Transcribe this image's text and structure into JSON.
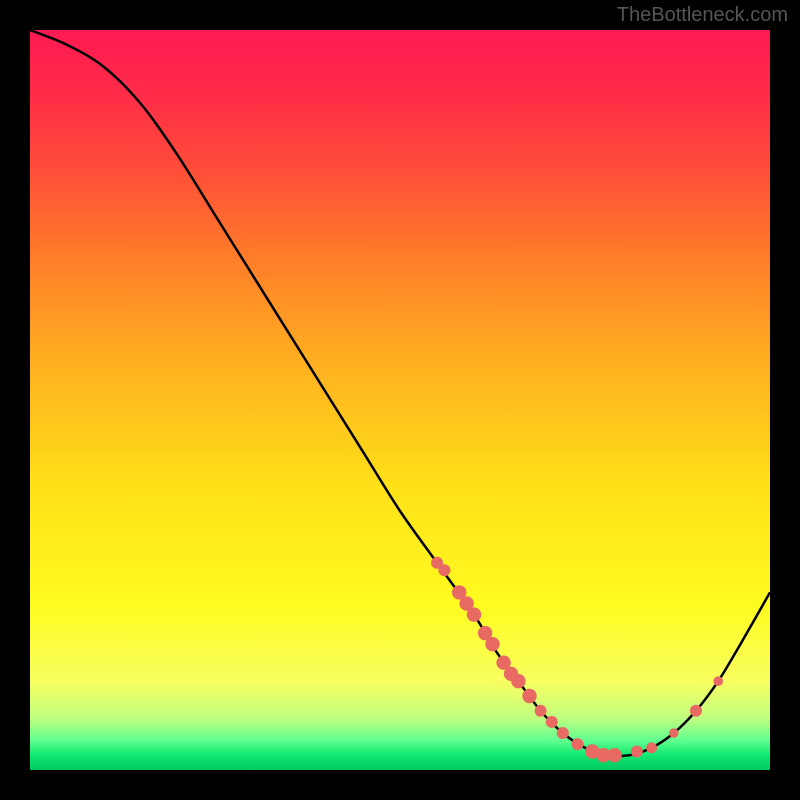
{
  "watermark": "TheBottleneck.com",
  "chart_data": {
    "type": "line",
    "title": "",
    "xlabel": "",
    "ylabel": "",
    "xlim": [
      0,
      100
    ],
    "ylim": [
      0,
      100
    ],
    "series": [
      {
        "name": "curve",
        "x": [
          0,
          5,
          10,
          15,
          20,
          25,
          30,
          35,
          40,
          45,
          50,
          55,
          60,
          63,
          66,
          69,
          72,
          75,
          78,
          81,
          84,
          87,
          90,
          93,
          96,
          100
        ],
        "y": [
          100,
          98,
          95,
          90,
          83,
          75,
          67,
          59,
          51,
          43,
          35,
          28,
          21,
          16,
          12,
          8,
          5,
          3,
          2,
          2,
          3,
          5,
          8,
          12,
          17,
          24
        ]
      }
    ],
    "markers": [
      {
        "x": 55,
        "y": 28,
        "r": 1.0
      },
      {
        "x": 56,
        "y": 27,
        "r": 1.0
      },
      {
        "x": 58,
        "y": 24,
        "r": 1.2
      },
      {
        "x": 59,
        "y": 22.5,
        "r": 1.2
      },
      {
        "x": 60,
        "y": 21,
        "r": 1.2
      },
      {
        "x": 61.5,
        "y": 18.5,
        "r": 1.2
      },
      {
        "x": 62.5,
        "y": 17,
        "r": 1.2
      },
      {
        "x": 64,
        "y": 14.5,
        "r": 1.2
      },
      {
        "x": 65,
        "y": 13,
        "r": 1.2
      },
      {
        "x": 66,
        "y": 12,
        "r": 1.2
      },
      {
        "x": 67.5,
        "y": 10,
        "r": 1.2
      },
      {
        "x": 69,
        "y": 8,
        "r": 1.0
      },
      {
        "x": 70.5,
        "y": 6.5,
        "r": 1.0
      },
      {
        "x": 72,
        "y": 5,
        "r": 1.0
      },
      {
        "x": 74,
        "y": 3.5,
        "r": 1.0
      },
      {
        "x": 76,
        "y": 2.5,
        "r": 1.2
      },
      {
        "x": 77.5,
        "y": 2,
        "r": 1.2
      },
      {
        "x": 79,
        "y": 2,
        "r": 1.2
      },
      {
        "x": 82,
        "y": 2.5,
        "r": 1.0
      },
      {
        "x": 84,
        "y": 3,
        "r": 0.9
      },
      {
        "x": 87,
        "y": 5,
        "r": 0.8
      },
      {
        "x": 90,
        "y": 8,
        "r": 1.0
      },
      {
        "x": 93,
        "y": 12,
        "r": 0.8
      }
    ]
  }
}
